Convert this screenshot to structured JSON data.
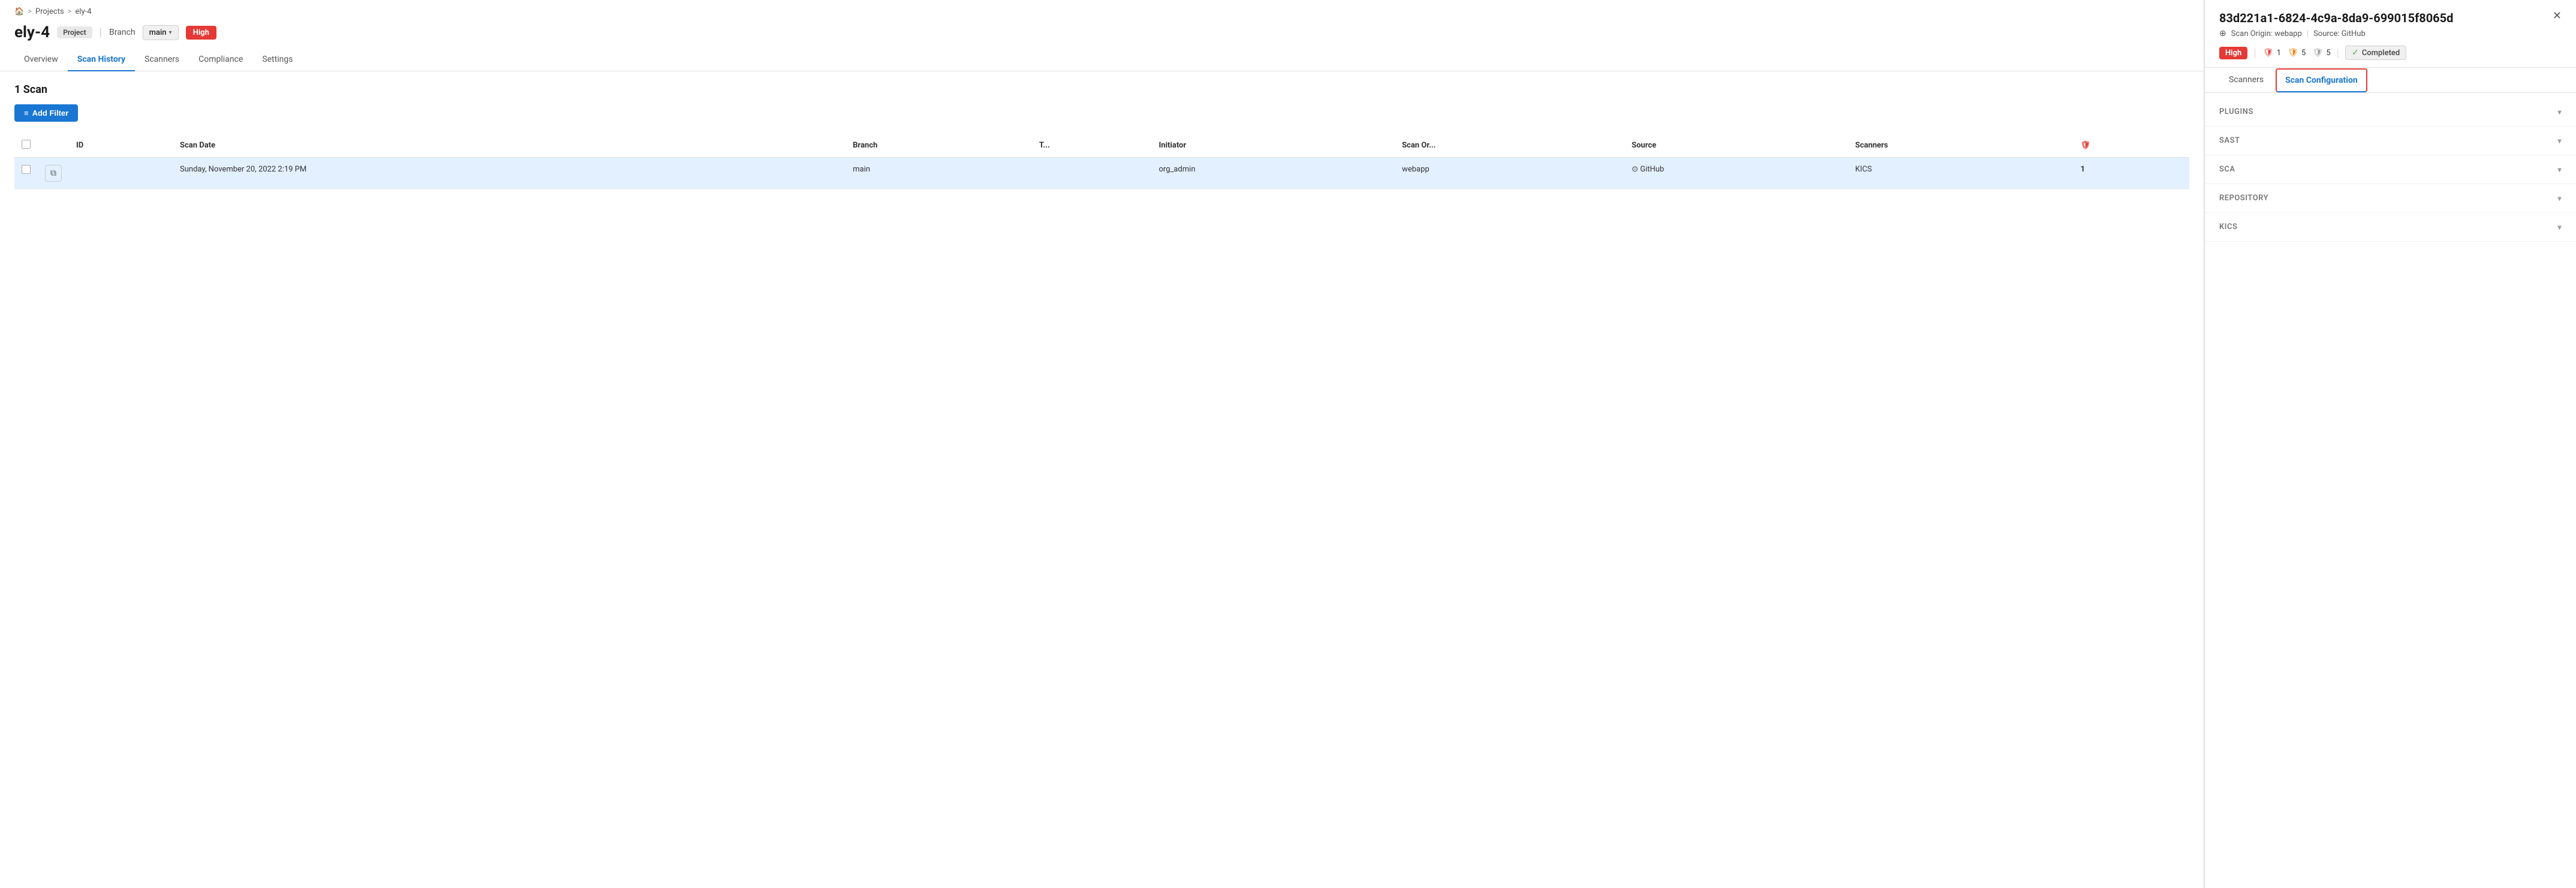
{
  "breadcrumb": {
    "home": "🏠",
    "projects": "Projects",
    "project_name": "ely-4"
  },
  "header": {
    "title": "ely-4",
    "project_badge": "Project",
    "branch_label": "Branch",
    "branch_value": "main",
    "severity": "High"
  },
  "tabs": [
    {
      "id": "overview",
      "label": "Overview",
      "active": false
    },
    {
      "id": "scan-history",
      "label": "Scan History",
      "active": true
    },
    {
      "id": "scanners",
      "label": "Scanners",
      "active": false
    },
    {
      "id": "compliance",
      "label": "Compliance",
      "active": false
    },
    {
      "id": "settings",
      "label": "Settings",
      "active": false
    }
  ],
  "scan_list": {
    "count_label": "1 Scan",
    "add_filter_label": "Add Filter"
  },
  "table": {
    "headers": [
      "",
      "",
      "ID",
      "Scan Date",
      "Branch",
      "T...",
      "Initiator",
      "Scan Or...",
      "Source",
      "Scanners",
      "🛡"
    ],
    "rows": [
      {
        "id": "",
        "scan_date": "Sunday, November 20, 2022 2:19 PM",
        "branch": "main",
        "type": "",
        "initiator": "org_admin",
        "scan_origin": "webapp",
        "source": "GitHub",
        "scanners": "KICS",
        "severity_count": "1",
        "selected": true
      }
    ]
  },
  "right_panel": {
    "scan_id": "83d221a1-6824-4c9a-8da9-699015f8065d",
    "origin_label": "Scan Origin: webapp",
    "source_label": "Source: GitHub",
    "severity": "High",
    "stats": {
      "critical_count": "1",
      "high_count": "5",
      "medium_count": "5"
    },
    "status": "Completed",
    "inner_tabs": [
      {
        "id": "scanners",
        "label": "Scanners",
        "active": false
      },
      {
        "id": "scan-configuration",
        "label": "Scan Configuration",
        "active": true
      }
    ],
    "accordion_sections": [
      {
        "id": "plugins",
        "label": "PLUGINS"
      },
      {
        "id": "sast",
        "label": "SAST"
      },
      {
        "id": "sca",
        "label": "SCA"
      },
      {
        "id": "repository",
        "label": "REPOSITORY"
      },
      {
        "id": "kics",
        "label": "KICS"
      }
    ],
    "close_label": "✕"
  }
}
